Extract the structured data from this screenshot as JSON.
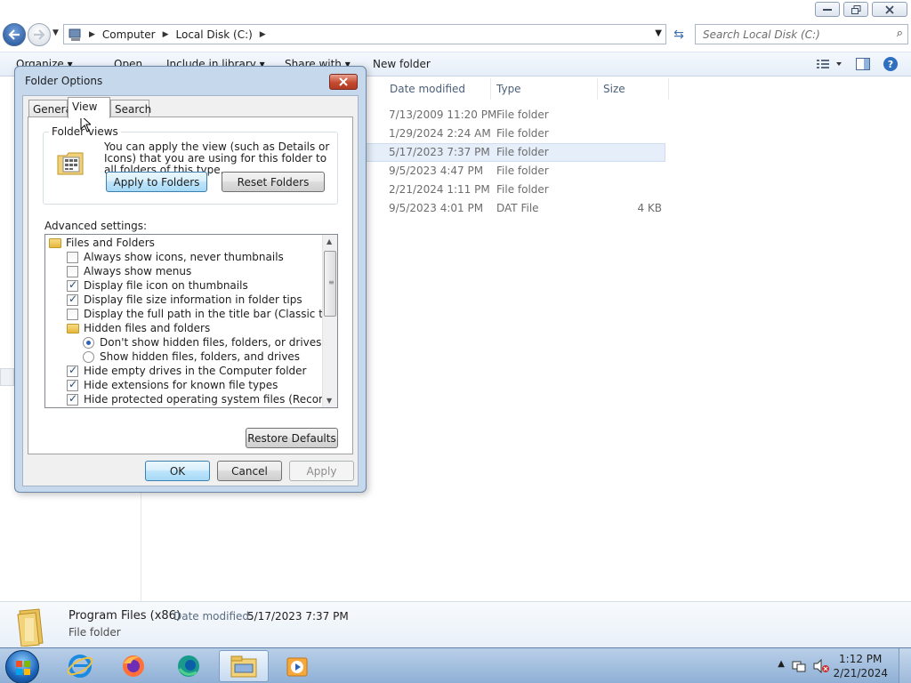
{
  "explorer": {
    "address": {
      "crumbs": [
        "Computer",
        "Local Disk (C:)"
      ]
    },
    "search": {
      "placeholder": "Search Local Disk (C:)"
    },
    "toolbar": {
      "organize": "Organize ▾",
      "open": "Open",
      "include": "Include in library ▾",
      "share": "Share with ▾",
      "new_folder": "New folder"
    },
    "columns": {
      "date_modified": "Date modified",
      "type": "Type",
      "size": "Size"
    },
    "files": [
      {
        "date": "7/13/2009 11:20 PM",
        "type": "File folder",
        "size": ""
      },
      {
        "date": "1/29/2024 2:24 AM",
        "type": "File folder",
        "size": ""
      },
      {
        "date": "5/17/2023 7:37 PM",
        "type": "File folder",
        "size": ""
      },
      {
        "date": "9/5/2023 4:47 PM",
        "type": "File folder",
        "size": ""
      },
      {
        "date": "2/21/2024 1:11 PM",
        "type": "File folder",
        "size": ""
      },
      {
        "date": "9/5/2023 4:01 PM",
        "type": "DAT File",
        "size": "4 KB"
      }
    ],
    "details": {
      "name": "Program Files (x86)",
      "date_label": "Date modified:",
      "date_value": "5/17/2023 7:37 PM",
      "type": "File folder"
    }
  },
  "dialog": {
    "title": "Folder Options",
    "tabs": [
      "General",
      "View",
      "Search"
    ],
    "active_tab": "View",
    "folder_views": {
      "legend": "Folder views",
      "description": "You can apply the view (such as Details or Icons) that you are using for this folder to all folders of this type.",
      "apply_button": "Apply to Folders",
      "reset_button": "Reset Folders"
    },
    "advanced_label": "Advanced settings:",
    "settings": [
      {
        "kind": "folder",
        "label": "Files and Folders",
        "level": 0
      },
      {
        "kind": "check",
        "checked": false,
        "label": "Always show icons, never thumbnails",
        "level": 1
      },
      {
        "kind": "check",
        "checked": false,
        "label": "Always show menus",
        "level": 1
      },
      {
        "kind": "check",
        "checked": true,
        "label": "Display file icon on thumbnails",
        "level": 1
      },
      {
        "kind": "check",
        "checked": true,
        "label": "Display file size information in folder tips",
        "level": 1
      },
      {
        "kind": "check",
        "checked": false,
        "label": "Display the full path in the title bar (Classic theme only)",
        "level": 1
      },
      {
        "kind": "folder",
        "label": "Hidden files and folders",
        "level": 1
      },
      {
        "kind": "radio",
        "checked": true,
        "label": "Don't show hidden files, folders, or drives",
        "level": 2
      },
      {
        "kind": "radio",
        "checked": false,
        "label": "Show hidden files, folders, and drives",
        "level": 2
      },
      {
        "kind": "check",
        "checked": true,
        "label": "Hide empty drives in the Computer folder",
        "level": 1
      },
      {
        "kind": "check",
        "checked": true,
        "label": "Hide extensions for known file types",
        "level": 1
      },
      {
        "kind": "check",
        "checked": true,
        "label": "Hide protected operating system files (Recommended)",
        "level": 1
      }
    ],
    "restore_button": "Restore Defaults",
    "ok_button": "OK",
    "cancel_button": "Cancel",
    "apply_button": "Apply"
  },
  "taskbar": {
    "clock_time": "1:12 PM",
    "clock_date": "2/21/2024",
    "pinned": [
      "internet-explorer-icon",
      "firefox-icon",
      "edge-icon",
      "explorer-icon",
      "media-player-icon"
    ]
  },
  "colors": {
    "selection": "#e5eef9",
    "dialog_frame": "#c6d8ec",
    "taskbar": "#a6c2e0"
  }
}
